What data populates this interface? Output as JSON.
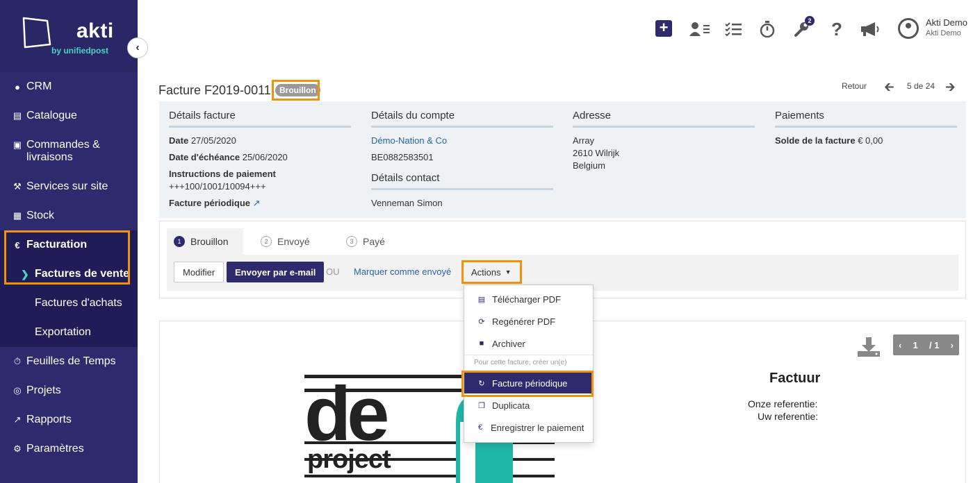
{
  "brand": {
    "name": "akti",
    "tagline": "by unifiedpost"
  },
  "sidebar": {
    "items": [
      {
        "label": "CRM",
        "icon": "user-icon"
      },
      {
        "label": "Catalogue",
        "icon": "book-icon"
      },
      {
        "label": "Commandes & livraisons",
        "icon": "cart-icon"
      },
      {
        "label": "Services sur site",
        "icon": "wrench-icon"
      },
      {
        "label": "Stock",
        "icon": "boxes-icon"
      },
      {
        "label": "Facturation",
        "icon": "euro-icon"
      },
      {
        "label": "Feuilles de Temps",
        "icon": "stopwatch-icon"
      },
      {
        "label": "Projets",
        "icon": "target-icon"
      },
      {
        "label": "Rapports",
        "icon": "chart-icon"
      },
      {
        "label": "Paramètres",
        "icon": "gear-icon"
      }
    ],
    "sub_items": [
      {
        "label": "Factures de vente"
      },
      {
        "label": "Factures d'achats"
      },
      {
        "label": "Exportation"
      }
    ]
  },
  "topbar": {
    "notifications_count": "2",
    "user_name": "Akti Demo",
    "user_org": "Akti Demo"
  },
  "invoice": {
    "title": "Facture F2019-0011",
    "status": "Brouillon",
    "back_label": "Retour",
    "position": "5 de 24"
  },
  "details": {
    "invoice_title": "Détails facture",
    "date_label": "Date",
    "date_value": "27/05/2020",
    "due_label": "Date d'échéance",
    "due_value": "25/06/2020",
    "payment_instr_label": "Instructions de paiement",
    "payment_instr_value": "+++100/1001/10094+++",
    "recurring_label": "Facture périodique",
    "account_title": "Détails du compte",
    "account_name": "Démo-Nation & Co",
    "account_vat": "BE0882583501",
    "contact_title": "Détails contact",
    "contact_name": "Venneman Simon",
    "address_title": "Adresse",
    "address_lines": [
      "Array",
      "2610 Wilrijk",
      "Belgium"
    ],
    "payments_title": "Paiements",
    "balance_label": "Solde de la facture",
    "balance_value": "€ 0,00"
  },
  "workflow": {
    "steps": [
      {
        "num": "1",
        "label": "Brouillon"
      },
      {
        "num": "2",
        "label": "Envoyé"
      },
      {
        "num": "3",
        "label": "Payé"
      }
    ],
    "edit_label": "Modifier",
    "send_label": "Envoyer par e-mail",
    "or_label": "OU",
    "mark_sent_label": "Marquer comme envoyé",
    "actions_label": "Actions"
  },
  "actions_menu": {
    "items": [
      {
        "label": "Télécharger PDF",
        "icon": "file-pdf-icon"
      },
      {
        "label": "Regénérer PDF",
        "icon": "refresh-icon"
      },
      {
        "label": "Archiver",
        "icon": "trash-icon"
      }
    ],
    "create_header": "Pour cette facture, créer un(e)",
    "create_items": [
      {
        "label": "Facture périodique",
        "icon": "redo-icon"
      },
      {
        "label": "Duplicata",
        "icon": "copy-icon"
      },
      {
        "label": "Enregistrer le paiement",
        "icon": "euro-icon"
      }
    ]
  },
  "preview": {
    "page_current": "1",
    "page_total": "/ 1",
    "doc_title": "Factuur",
    "ref_ours": "Onze referentie:",
    "ref_yours": "Uw referentie:",
    "logo_word_top": "de",
    "logo_word_bottom": "project"
  },
  "colors": {
    "sidebar": "#2d2a6e",
    "highlight": "#f0930c",
    "teal": "#4fd1c5",
    "link": "#2a63a8"
  }
}
